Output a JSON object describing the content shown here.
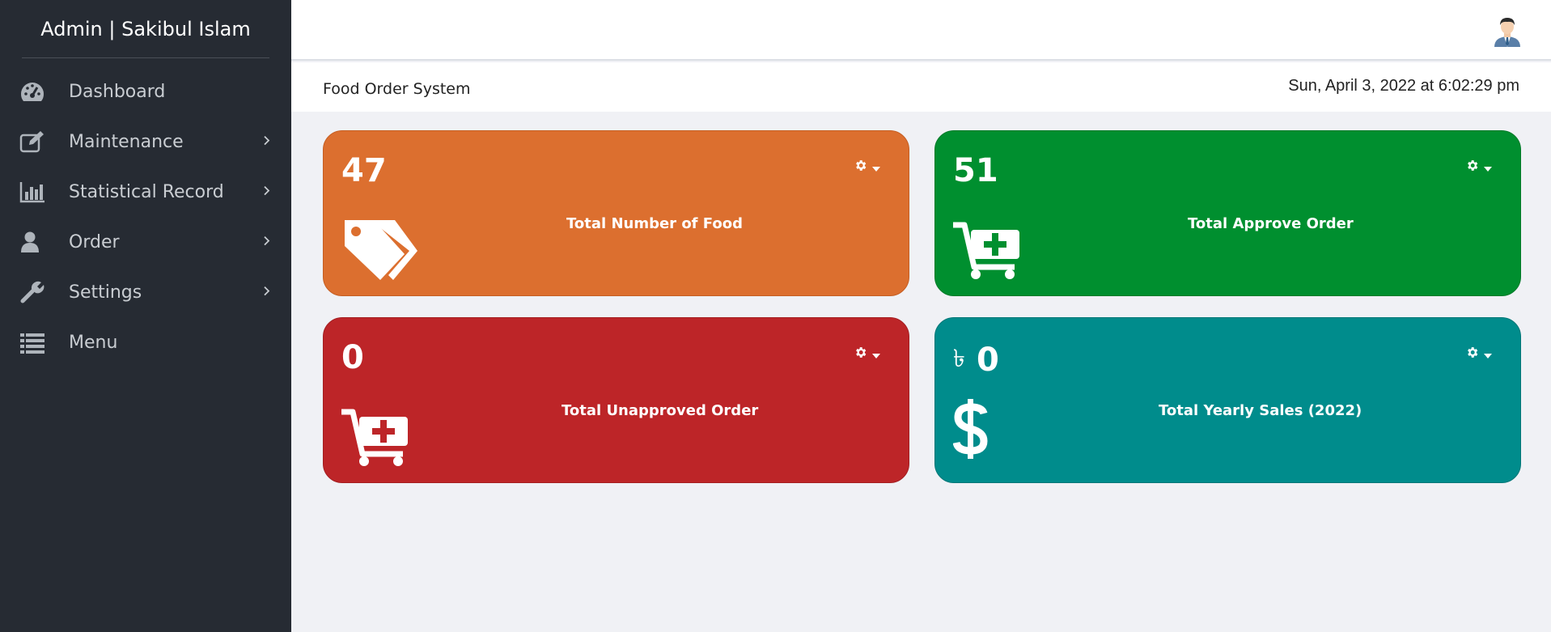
{
  "sidebar": {
    "brand": "Admin | Sakibul Islam",
    "items": [
      {
        "label": "Dashboard",
        "icon": "dashboard-gauge-icon",
        "has_submenu": false
      },
      {
        "label": "Maintenance",
        "icon": "edit-icon",
        "has_submenu": true
      },
      {
        "label": "Statistical Record",
        "icon": "bar-chart-icon",
        "has_submenu": true
      },
      {
        "label": "Order",
        "icon": "user-icon",
        "has_submenu": true
      },
      {
        "label": "Settings",
        "icon": "wrench-icon",
        "has_submenu": true
      },
      {
        "label": "Menu",
        "icon": "list-icon",
        "has_submenu": false
      }
    ]
  },
  "header": {
    "avatar_icon": "user-avatar-icon"
  },
  "subheader": {
    "app_name": "Food Order System",
    "datetime": "Sun, April 3, 2022 at 6:02:29 pm"
  },
  "cards": [
    {
      "value": "47",
      "label": "Total Number of Food",
      "icon": "tags-icon",
      "color": "#dc6f2f"
    },
    {
      "value": "51",
      "label": "Total Approve Order",
      "icon": "cart-plus-icon",
      "color": "#008f2f"
    },
    {
      "value": "0",
      "label": "Total Unapproved Order",
      "icon": "cart-plus-icon",
      "color": "#bd2528"
    },
    {
      "currency": "৳",
      "value": "0",
      "label": "Total Yearly Sales (2022)",
      "icon": "dollar-icon",
      "color": "#008c8c"
    }
  ],
  "colors": {
    "sidebar_bg": "#262b33",
    "page_bg": "#f0f1f5",
    "orange": "#dc6f2f",
    "green": "#008f2f",
    "red": "#bd2528",
    "teal": "#008c8c"
  }
}
